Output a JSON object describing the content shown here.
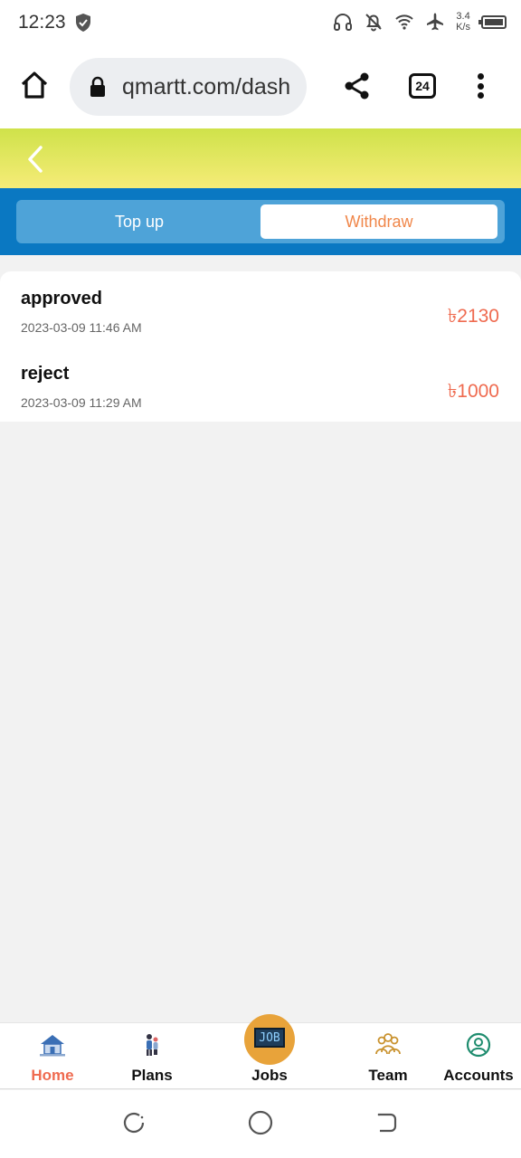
{
  "status_bar": {
    "time": "12:23",
    "net_speed_value": "3.4",
    "net_speed_unit": "K/s",
    "icons": [
      "shield-icon",
      "headphones-icon",
      "bell-off-icon",
      "wifi-icon",
      "airplane-icon",
      "battery-icon"
    ]
  },
  "browser": {
    "url": "qmartt.com/dash",
    "tab_count": "24",
    "icons": [
      "home-icon",
      "lock-icon",
      "share-icon",
      "tabs-icon",
      "more-vert-icon"
    ]
  },
  "header": {
    "back_icon": "chevron-left-icon",
    "accent_gradient": [
      "#cfe24a",
      "#f6ec78"
    ]
  },
  "tabs": {
    "items": [
      {
        "label": "Top up",
        "active": false
      },
      {
        "label": "Withdraw",
        "active": true
      }
    ],
    "band_color": "#0a78c2",
    "active_text_color": "#f0874a"
  },
  "records": [
    {
      "status": "approved",
      "datetime": "2023-03-09 11:46 AM",
      "amount": "৳2130"
    },
    {
      "status": "reject",
      "datetime": "2023-03-09 11:29 AM",
      "amount": "৳1000"
    }
  ],
  "amount_color": "#ef6b50",
  "bottom_nav": {
    "items": [
      {
        "label": "Home",
        "icon": "home-house-icon",
        "active": true
      },
      {
        "label": "Plans",
        "icon": "plans-people-icon",
        "active": false
      },
      {
        "label": "Jobs",
        "icon": "job-board-icon",
        "icon_text": "JOB",
        "active": false
      },
      {
        "label": "Team",
        "icon": "team-icon",
        "active": false
      },
      {
        "label": "Accounts",
        "icon": "account-icon",
        "active": false
      }
    ]
  },
  "system_nav": {
    "icons": [
      "recents-icon",
      "home-circle-icon",
      "back-icon"
    ]
  }
}
